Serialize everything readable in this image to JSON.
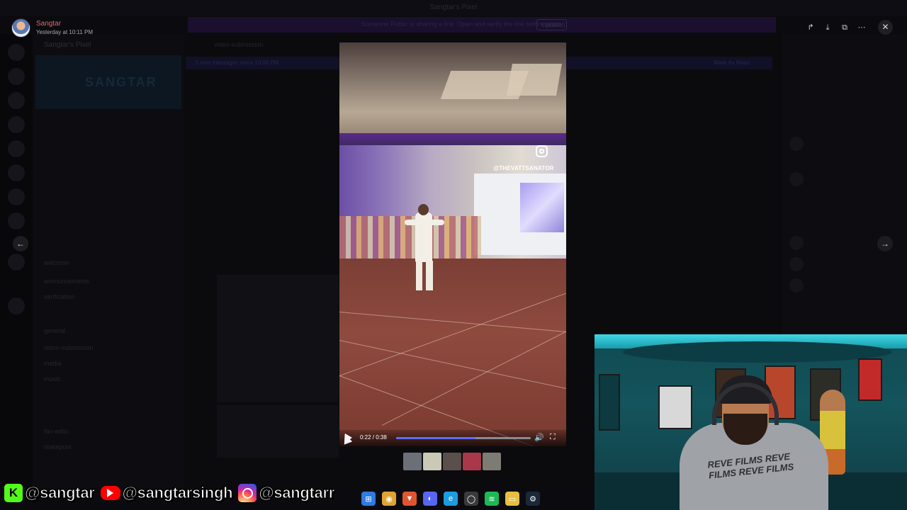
{
  "window": {
    "title": "Sangtar's Pixel"
  },
  "background": {
    "banner_text": "Someone Public is sharing a link. Open and verify the link before visiting.",
    "banner_button": "Update",
    "server_name": "Sangtar's Pixel",
    "server_banner_text": "SANGTAR",
    "channels": [
      "welcome",
      "announcements",
      "verification",
      "general",
      "video-submission",
      "media",
      "music",
      "fan-edits",
      "stakepool"
    ],
    "chat_header": "video-submission",
    "new_messages_bar": "5 new messages since 10:06 PM",
    "mark_as_read": "Mark As Read"
  },
  "lightbox": {
    "author": "Sangtar",
    "timestamp": "Yesterday at 10:11 PM",
    "tools": [
      {
        "name": "forward-icon",
        "glyph": "↱"
      },
      {
        "name": "download-icon",
        "glyph": "⤓"
      },
      {
        "name": "open-external-icon",
        "glyph": "⧉"
      },
      {
        "name": "more-icon",
        "glyph": "⋯"
      }
    ],
    "close_glyph": "✕",
    "prev_glyph": "←",
    "next_glyph": "→"
  },
  "video": {
    "watermark_handle": "@THEVATTSANATOR",
    "time": "0:22 / 0:38",
    "progress": 0.59,
    "volume_glyph": "🔊",
    "fullscreen_glyph": "⛶"
  },
  "thumbnails": [
    {
      "name": "thumb-1",
      "color": "#6a6f78"
    },
    {
      "name": "thumb-2",
      "color": "#c9c9b6"
    },
    {
      "name": "thumb-3",
      "color": "#5a4f4a"
    },
    {
      "name": "thumb-4",
      "color": "#a8384a"
    },
    {
      "name": "thumb-5",
      "color": "#7e7a74"
    }
  ],
  "webcam": {
    "shirt_text": "REVE FILMS REVE FILMS REVE FILMS"
  },
  "social": [
    {
      "icon": "kick-icon",
      "glyph": "K",
      "handle": "@sangtar"
    },
    {
      "icon": "youtube-icon",
      "glyph": "",
      "handle": "@sangtarsingh"
    },
    {
      "icon": "instagram-icon",
      "glyph": "",
      "handle": "@sangtarr"
    }
  ],
  "taskbar": [
    {
      "name": "start-icon",
      "color": "#2f7be0",
      "glyph": "⊞"
    },
    {
      "name": "chrome-icon",
      "color": "#e0a52f",
      "glyph": "◉"
    },
    {
      "name": "brave-icon",
      "color": "#e0552f",
      "glyph": "▼"
    },
    {
      "name": "discord-icon",
      "color": "#5865f2",
      "glyph": "◐"
    },
    {
      "name": "edge-icon",
      "color": "#1b9de2",
      "glyph": "e"
    },
    {
      "name": "github-icon",
      "color": "#3a3a3a",
      "glyph": "◯"
    },
    {
      "name": "spotify-icon",
      "color": "#1db954",
      "glyph": "≋"
    },
    {
      "name": "file-explorer-icon",
      "color": "#e8c040",
      "glyph": "▭"
    },
    {
      "name": "steam-icon",
      "color": "#1b2838",
      "glyph": "⚙"
    }
  ]
}
